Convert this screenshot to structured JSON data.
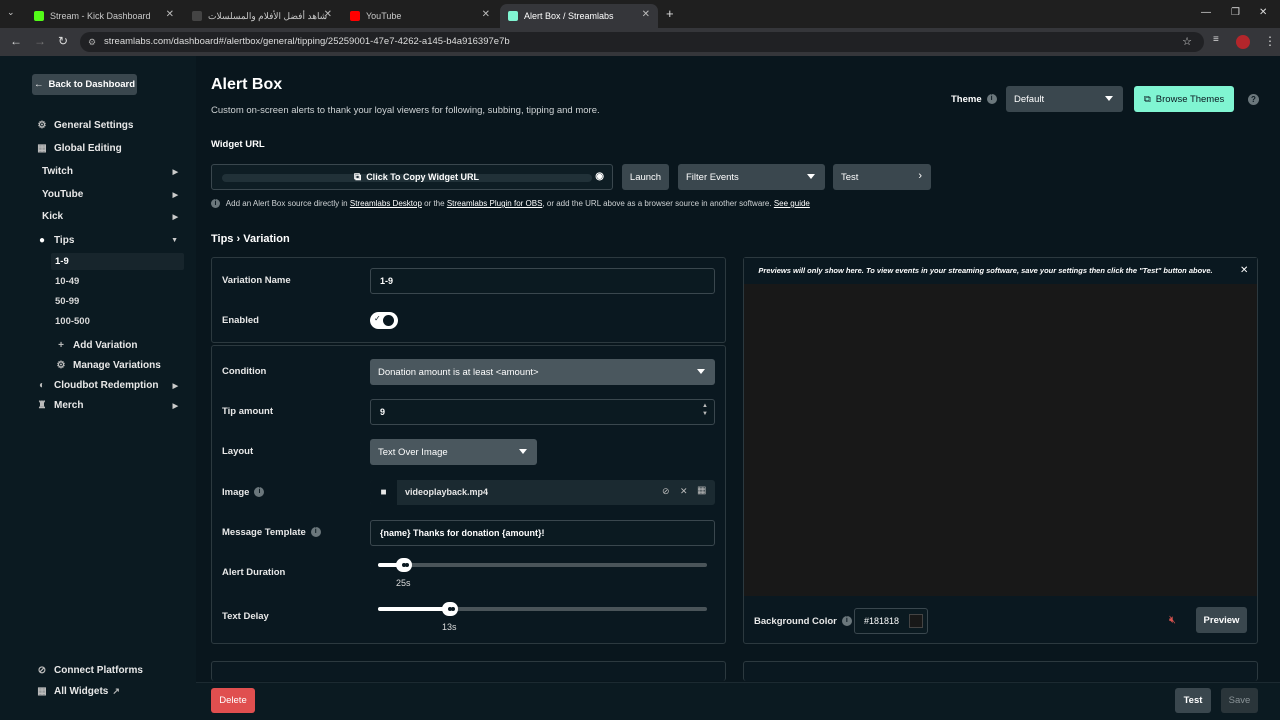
{
  "browser": {
    "tabs": [
      {
        "title": "Stream - Kick Dashboard",
        "favicon_color": "#53fc18"
      },
      {
        "title": "شاهد أفضل الأفلام والمسلسلات",
        "favicon_color": "#222222"
      },
      {
        "title": "YouTube",
        "favicon_color": "#ff0000"
      },
      {
        "title": "Alert Box / Streamlabs",
        "favicon_color": "#80f5d2"
      }
    ],
    "url": "streamlabs.com/dashboard#/alertbox/general/tipping/25259001-47e7-4262-a145-b4a916397e7b"
  },
  "sidebar": {
    "back_label": "Back to Dashboard",
    "items": [
      {
        "label": "General Settings",
        "icon": "gear-icon"
      },
      {
        "label": "Global Editing",
        "icon": "grid-icon"
      },
      {
        "label": "Twitch",
        "icon": ""
      },
      {
        "label": "YouTube",
        "icon": ""
      },
      {
        "label": "Kick",
        "icon": ""
      },
      {
        "label": "Tips",
        "icon": "coins-icon"
      }
    ],
    "tip_variations": [
      "1-9",
      "10-49",
      "50-99",
      "100-500"
    ],
    "actions": [
      "Add Variation",
      "Manage Variations"
    ],
    "more": [
      "Cloudbot Redemption",
      "Merch"
    ],
    "footer": [
      "Connect Platforms",
      "All Widgets"
    ]
  },
  "header": {
    "title": "Alert Box",
    "description": "Custom on-screen alerts to thank your loyal viewers for following, subbing, tipping and more.",
    "theme_label": "Theme",
    "theme_value": "Default",
    "browse_themes": "Browse Themes"
  },
  "widget": {
    "label": "Widget URL",
    "copy_label": "Click To Copy Widget URL",
    "launch": "Launch",
    "filter_events": "Filter Events",
    "test": "Test",
    "hint_1": "Add an Alert Box source directly in",
    "hint_link_1": "Streamlabs Desktop",
    "hint_2": "or the",
    "hint_link_2": "Streamlabs Plugin for OBS",
    "hint_3": ", or add the URL above as a browser source in another software.",
    "hint_link_3": "See guide"
  },
  "breadcrumb": {
    "section": "Tips",
    "separator": "›",
    "page": "Variation"
  },
  "form": {
    "variation_name_label": "Variation Name",
    "variation_name": "1-9",
    "enabled_label": "Enabled",
    "enabled": true,
    "condition_label": "Condition",
    "condition_value": "Donation amount is at least <amount>",
    "tip_amount_label": "Tip amount",
    "tip_amount": "9",
    "layout_label": "Layout",
    "layout_value": "Text Over Image",
    "image_label": "Image",
    "image_file": "videoplayback.mp4",
    "message_label": "Message Template",
    "message_value": "{name} Thanks for donation {amount}!",
    "duration_label": "Alert Duration",
    "duration_value": "25s",
    "duration_fraction": 0.08,
    "delay_label": "Text Delay",
    "delay_value": "13s",
    "delay_fraction": 0.22
  },
  "preview": {
    "notice": "Previews will only show here. To view events in your streaming software, save your settings then click the \"Test\" button above.",
    "bg_label": "Background Color",
    "bg_value": "#181818",
    "preview_btn": "Preview"
  },
  "footer": {
    "delete": "Delete",
    "test": "Test",
    "save": "Save"
  },
  "colors": {
    "accent": "#80f5d2",
    "danger": "#e04f4f",
    "panel_border": "#2c393f"
  }
}
